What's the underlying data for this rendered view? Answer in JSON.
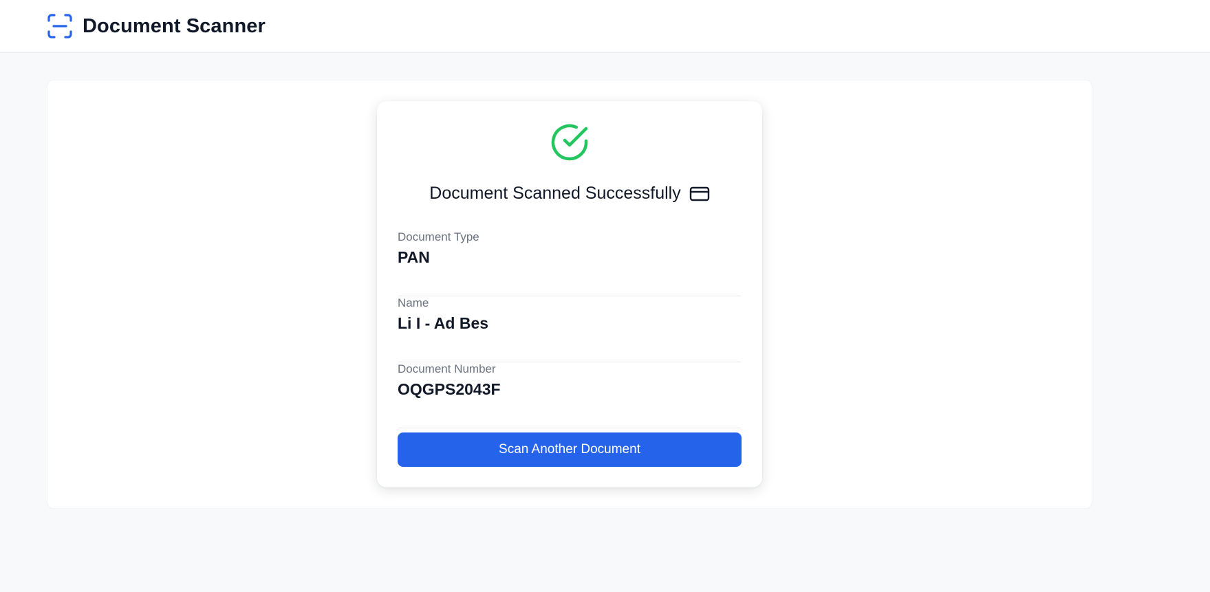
{
  "header": {
    "title": "Document Scanner",
    "logo_icon": "scan-icon",
    "accent_color": "#2563eb"
  },
  "result": {
    "status_icon": "check-circle-icon",
    "status_color": "#22c55e",
    "title": "Document Scanned Successfully",
    "title_icon": "credit-card-icon",
    "fields": [
      {
        "label": "Document Type",
        "value": "PAN"
      },
      {
        "label": "Name",
        "value": "Li I - Ad Bes"
      },
      {
        "label": "Document Number",
        "value": "OQGPS2043F"
      }
    ],
    "action_label": "Scan Another Document"
  }
}
